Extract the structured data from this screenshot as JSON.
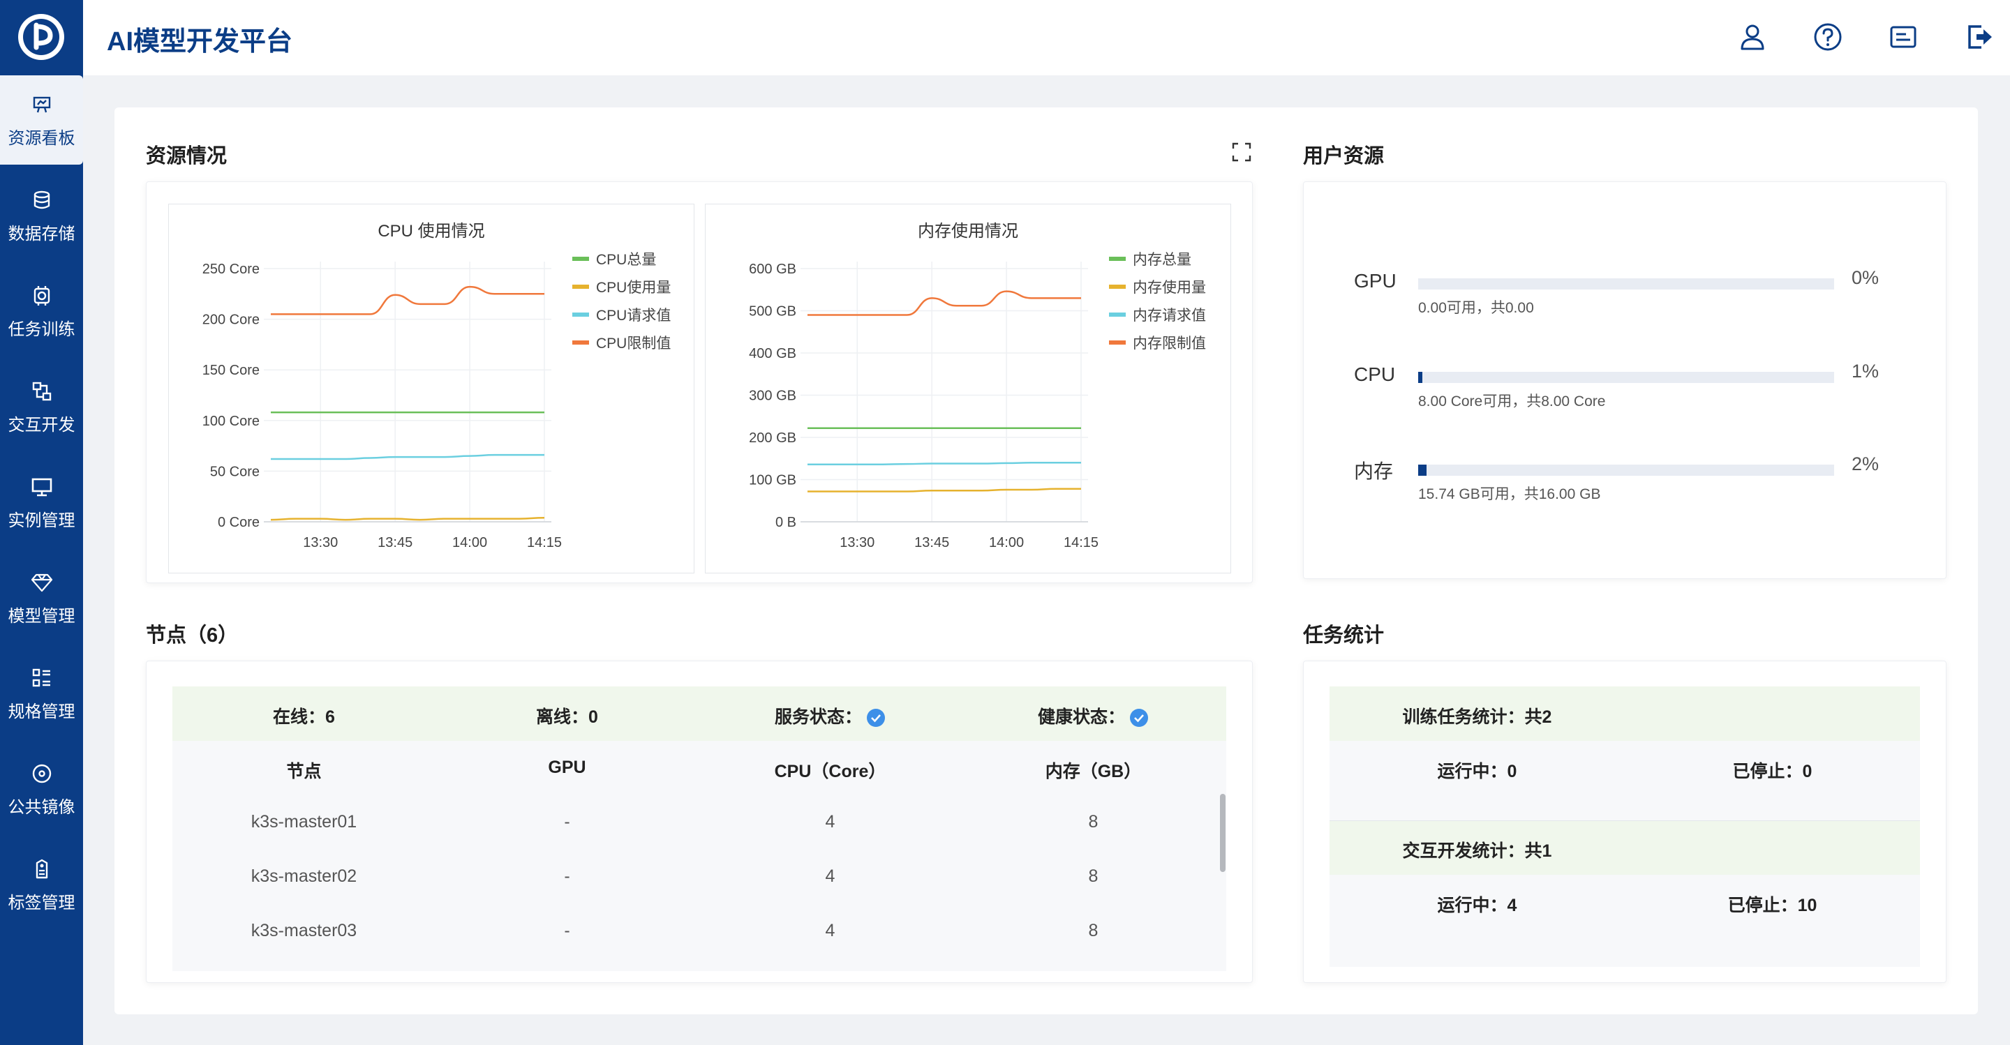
{
  "app": {
    "title": "AI模型开发平台"
  },
  "sidebar": {
    "items": [
      {
        "label": "资源看板",
        "icon": "dashboard-icon",
        "active": true
      },
      {
        "label": "数据存储",
        "icon": "database-icon"
      },
      {
        "label": "任务训练",
        "icon": "training-icon"
      },
      {
        "label": "交互开发",
        "icon": "dev-icon"
      },
      {
        "label": "实例管理",
        "icon": "monitor-icon"
      },
      {
        "label": "模型管理",
        "icon": "diamond-icon"
      },
      {
        "label": "规格管理",
        "icon": "list-icon"
      },
      {
        "label": "公共镜像",
        "icon": "disc-icon"
      },
      {
        "label": "标签管理",
        "icon": "tag-icon"
      }
    ]
  },
  "header": {
    "icons": [
      "user-icon",
      "help-icon",
      "message-icon",
      "logout-icon"
    ]
  },
  "resources": {
    "title": "资源情况",
    "cpu_chart_title": "CPU 使用情况",
    "mem_chart_title": "内存使用情况"
  },
  "chart_data": [
    {
      "type": "line",
      "title": "CPU 使用情况",
      "x": [
        "13:20",
        "13:25",
        "13:30",
        "13:35",
        "13:40",
        "13:45",
        "13:50",
        "13:55",
        "14:00",
        "14:05",
        "14:10",
        "14:15"
      ],
      "x_ticks": [
        "13:30",
        "13:45",
        "14:00",
        "14:15"
      ],
      "y_ticks": [
        "0 Core",
        "50 Core",
        "100 Core",
        "150 Core",
        "200 Core",
        "250 Core"
      ],
      "ylim": [
        0,
        250
      ],
      "series": [
        {
          "name": "CPU总量",
          "color": "#6abf59",
          "values": [
            108,
            108,
            108,
            108,
            108,
            108,
            108,
            108,
            108,
            108,
            108,
            108
          ]
        },
        {
          "name": "CPU使用量",
          "color": "#e6b22e",
          "values": [
            2,
            3,
            3,
            2,
            3,
            3,
            2,
            3,
            3,
            3,
            3,
            4
          ]
        },
        {
          "name": "CPU请求值",
          "color": "#6bcfe0",
          "values": [
            62,
            62,
            62,
            62,
            63,
            64,
            64,
            64,
            65,
            66,
            66,
            66
          ]
        },
        {
          "name": "CPU限制值",
          "color": "#f0783c",
          "values": [
            205,
            205,
            205,
            205,
            205,
            224,
            215,
            215,
            232,
            225,
            225,
            225
          ]
        }
      ]
    },
    {
      "type": "line",
      "title": "内存使用情况",
      "x": [
        "13:20",
        "13:25",
        "13:30",
        "13:35",
        "13:40",
        "13:45",
        "13:50",
        "13:55",
        "14:00",
        "14:05",
        "14:10",
        "14:15"
      ],
      "x_ticks": [
        "13:30",
        "13:45",
        "14:00",
        "14:15"
      ],
      "y_ticks": [
        "0 B",
        "100 GB",
        "200 GB",
        "300 GB",
        "400 GB",
        "500 GB",
        "600 GB"
      ],
      "ylim": [
        0,
        600
      ],
      "series": [
        {
          "name": "内存总量",
          "color": "#6abf59",
          "values": [
            222,
            222,
            222,
            222,
            222,
            222,
            222,
            222,
            222,
            222,
            222,
            222
          ]
        },
        {
          "name": "内存使用量",
          "color": "#e6b22e",
          "values": [
            72,
            72,
            72,
            72,
            72,
            74,
            74,
            74,
            76,
            76,
            78,
            78
          ]
        },
        {
          "name": "内存请求值",
          "color": "#6bcfe0",
          "values": [
            136,
            136,
            136,
            136,
            137,
            138,
            138,
            138,
            139,
            140,
            140,
            140
          ]
        },
        {
          "name": "内存限制值",
          "color": "#f0783c",
          "values": [
            490,
            490,
            490,
            490,
            490,
            530,
            512,
            512,
            546,
            530,
            530,
            530
          ]
        }
      ]
    }
  ],
  "user_resources": {
    "title": "用户资源",
    "items": [
      {
        "label": "GPU",
        "percent_text": "0%",
        "fraction": 0.0,
        "sub": "0.00可用，共0.00"
      },
      {
        "label": "CPU",
        "percent_text": "1%",
        "fraction": 0.01,
        "sub": "8.00 Core可用，共8.00 Core"
      },
      {
        "label": "内存",
        "percent_text": "2%",
        "fraction": 0.02,
        "sub": "15.74 GB可用，共16.00 GB"
      }
    ]
  },
  "nodes": {
    "title": "节点（6）",
    "summary": {
      "online": "在线：6",
      "offline": "离线：0",
      "service": "服务状态：",
      "health": "健康状态："
    },
    "columns": [
      "节点",
      "GPU",
      "CPU（Core）",
      "内存（GB）"
    ],
    "rows": [
      [
        "k3s-master01",
        "-",
        "4",
        "8"
      ],
      [
        "k3s-master02",
        "-",
        "4",
        "8"
      ],
      [
        "k3s-master03",
        "-",
        "4",
        "8"
      ]
    ]
  },
  "tasks": {
    "title": "任务统计",
    "training": {
      "title": "训练任务统计：共2",
      "running": "运行中：0",
      "stopped": "已停止：0"
    },
    "interactive": {
      "title": "交互开发统计：共1",
      "running": "运行中：4",
      "stopped": "已停止：10"
    }
  }
}
